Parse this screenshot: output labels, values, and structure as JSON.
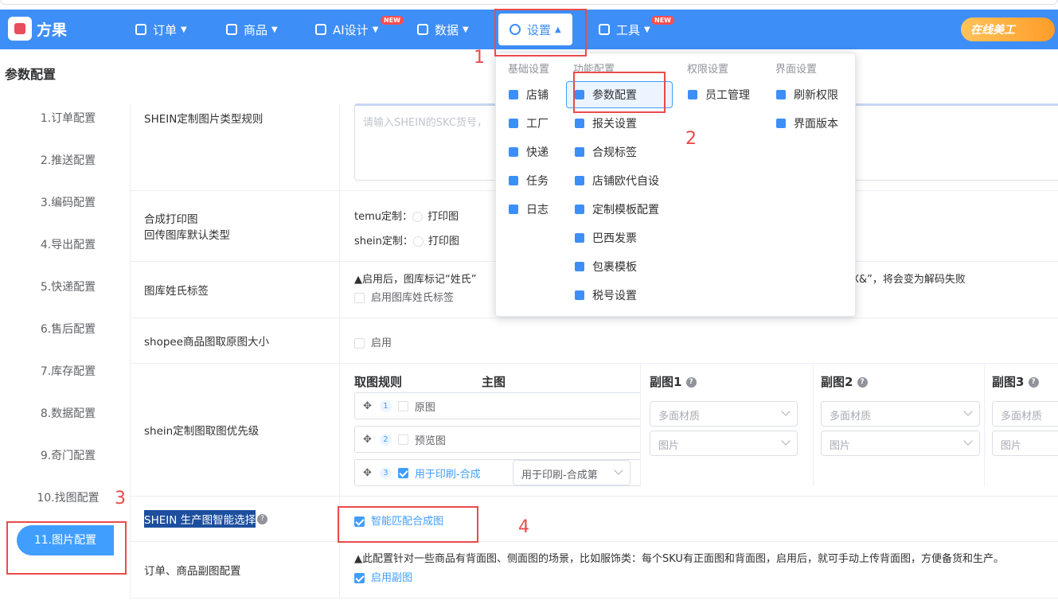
{
  "app_name": "方果",
  "nav": [
    {
      "label": "订单"
    },
    {
      "label": "商品"
    },
    {
      "label": "AI设计",
      "badge": "NEW"
    },
    {
      "label": "数据"
    },
    {
      "label": "设置"
    },
    {
      "label": "工具",
      "badge": "NEW"
    }
  ],
  "promo": "在线美工",
  "page_title": "参数配置",
  "sidebar": [
    "1.订单配置",
    "2.推送配置",
    "3.编码配置",
    "4.导出配置",
    "5.快递配置",
    "6.售后配置",
    "7.库存配置",
    "8.数据配置",
    "9.奇门配置",
    "10.找图配置",
    "11.图片配置"
  ],
  "rows": {
    "r1_label": "SHEIN定制图片类型规则",
    "r1_placeholder": "请输入SHEIN的SKC货号，",
    "r2_label_a": "合成打印图",
    "r2_label_b": "回传图库默认类型",
    "r2_temu": "temu定制：",
    "r2_shein": "shein定制：",
    "r2_opt": "打印图",
    "r3_label": "图库姓氏标签",
    "r3_warn_a": "▲启用后，图库标记“姓氏”",
    "r3_warn_b": "&X&”，将会变为解码失败",
    "r3_chk": "启用图库姓氏标签",
    "r4_label": "shopee商品图取原图大小",
    "r4_chk": "启用",
    "r5_label": "shein定制图取图优先级",
    "r5_h1": "取图规则",
    "r5_h2": "主图",
    "r5_h3": "副图1",
    "r5_h4": "副图2",
    "r5_h5": "副图3",
    "r5_item1": "原图",
    "r5_item2": "预览图",
    "r5_item3": "用于印刷-合成",
    "r5_item3_sel": "用于印刷-合成第",
    "r5_sel_a": "多面材质",
    "r5_sel_b": "图片",
    "r6_label": "SHEIN 生产图智能选择",
    "r6_chk": "智能匹配合成图",
    "r7_label": "订单、商品副图配置",
    "r7_warn": "▲此配置针对一些商品有背面图、侧面图的场景，比如服饰类：每个SKU有正面图和背面图，启用后，就可手动上传背面图，方便备货和生产。",
    "r7_chk": "启用副图"
  },
  "dropdown": {
    "heads": [
      "基础设置",
      "功能配置",
      "权限设置",
      "界面设置"
    ],
    "col1": [
      "店铺",
      "工厂",
      "快递",
      "任务",
      "日志"
    ],
    "col2": [
      "参数配置",
      "报关设置",
      "合规标签",
      "店铺欧代自设",
      "定制模板配置",
      "巴西发票",
      "包裹模板",
      "税号设置"
    ],
    "col3": [
      "员工管理"
    ],
    "col4": [
      "刷新权限",
      "界面版本"
    ]
  },
  "annotations": [
    "1",
    "2",
    "3",
    "4"
  ],
  "colors": {
    "nav_bg": "#3e8ef7",
    "accent": "#409eff",
    "annotation": "#e94b4b"
  }
}
